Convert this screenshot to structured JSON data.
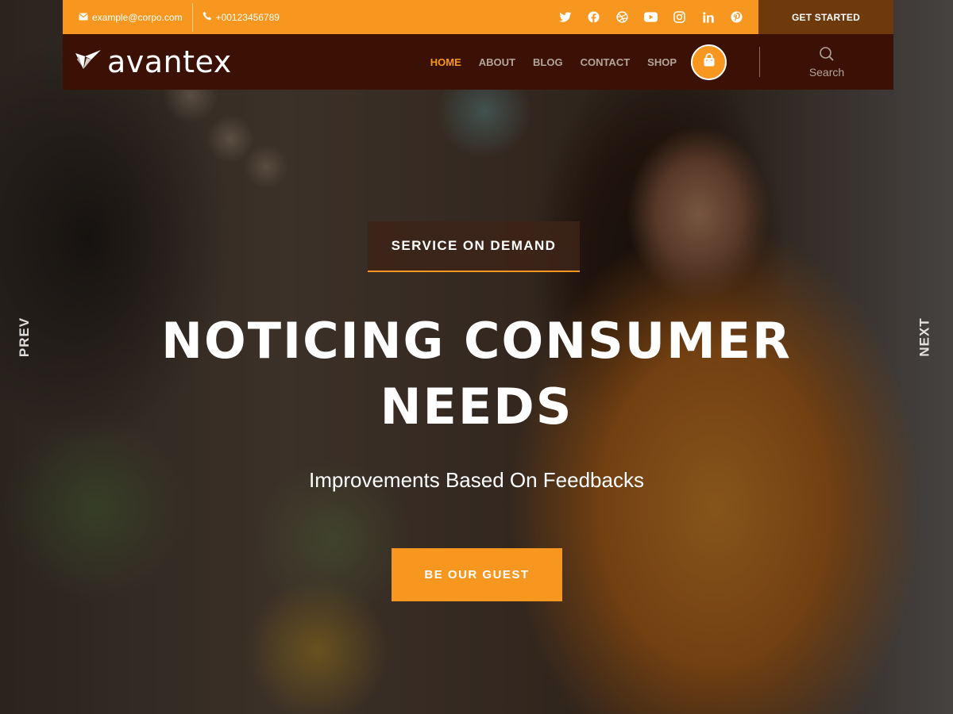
{
  "topbar": {
    "email": "example@corpo.com",
    "phone": "+00123456789",
    "social_icons": [
      "twitter-icon",
      "facebook-icon",
      "dribbble-icon",
      "youtube-icon",
      "instagram-icon",
      "linkedin-icon",
      "pinterest-icon"
    ],
    "cta_label": "GET STARTED"
  },
  "nav": {
    "logo_text": "avantex",
    "links": [
      "HOME",
      "ABOUT",
      "BLOG",
      "CONTACT",
      "SHOP"
    ],
    "active_index": 0,
    "search_label": "Search"
  },
  "hero": {
    "tag": "SERVICE ON DEMAND",
    "headline_line1": "NOTICING CONSUMER",
    "headline_line2": "NEEDS",
    "subline": "Improvements Based On Feedbacks",
    "cta_label": "BE OUR GUEST",
    "prev_label": "PREV",
    "next_label": "NEXT"
  },
  "colors": {
    "accent": "#f7971f",
    "nav_bg": "#3b1106",
    "get_started_bg": "#6e3a0c"
  }
}
